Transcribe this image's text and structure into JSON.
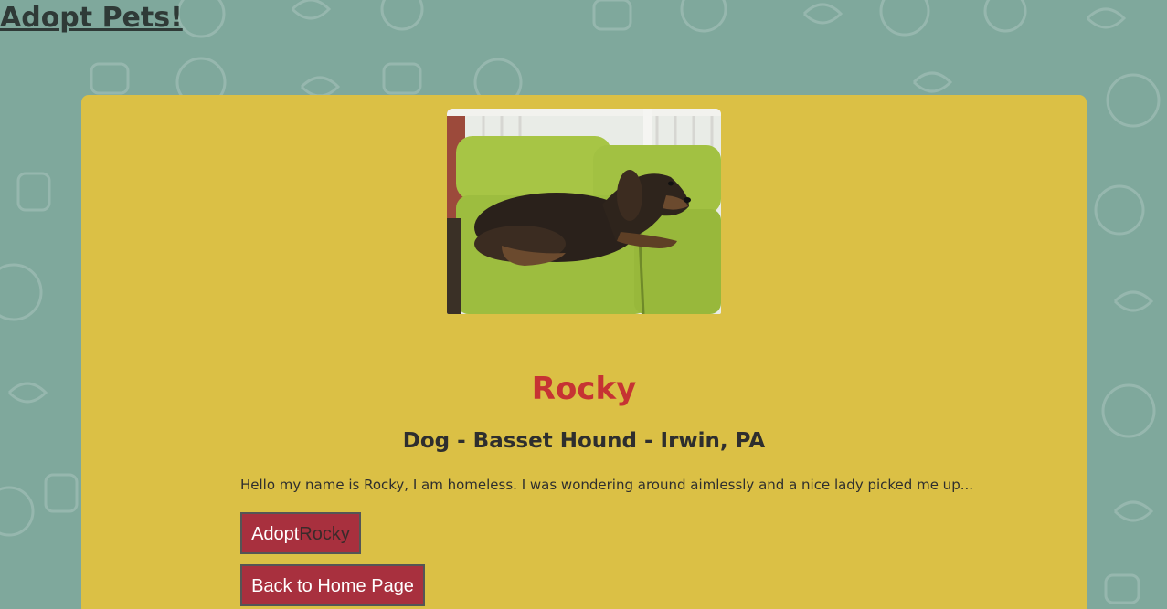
{
  "site": {
    "title": "Adopt Pets!"
  },
  "pet": {
    "name": "Rocky",
    "info": "Dog - Basset Hound - Irwin, PA",
    "description": "Hello my name is Rocky, I am homeless. I was wondering around aimlessly and a nice lady picked me up..."
  },
  "actions": {
    "adopt_prefix": "Adopt",
    "adopt_name": "Rocky",
    "back_label": "Back to Home Page"
  },
  "colors": {
    "page_bg": "#7fa89c",
    "card_bg": "#dbc045",
    "name_color": "#c63333",
    "button_bg": "#a8303e"
  }
}
